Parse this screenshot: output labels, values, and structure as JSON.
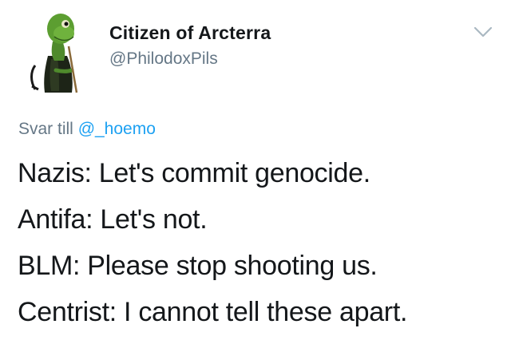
{
  "tweet": {
    "display_name": "Citizen of Arcterra",
    "handle": "@PhilodoxPils",
    "avatar_icon": "lizard-avatar-icon",
    "caret_icon": "chevron-down-icon",
    "reply_prefix": "Svar till ",
    "reply_mention": "@_hoemo",
    "lines": [
      "Nazis: Let's commit genocide.",
      "Antifa: Let's not.",
      "BLM: Please stop shooting us.",
      "Centrist: I cannot tell these apart."
    ]
  },
  "colors": {
    "text": "#14171a",
    "muted": "#657786",
    "link": "#1da1f2",
    "background": "#ffffff"
  }
}
